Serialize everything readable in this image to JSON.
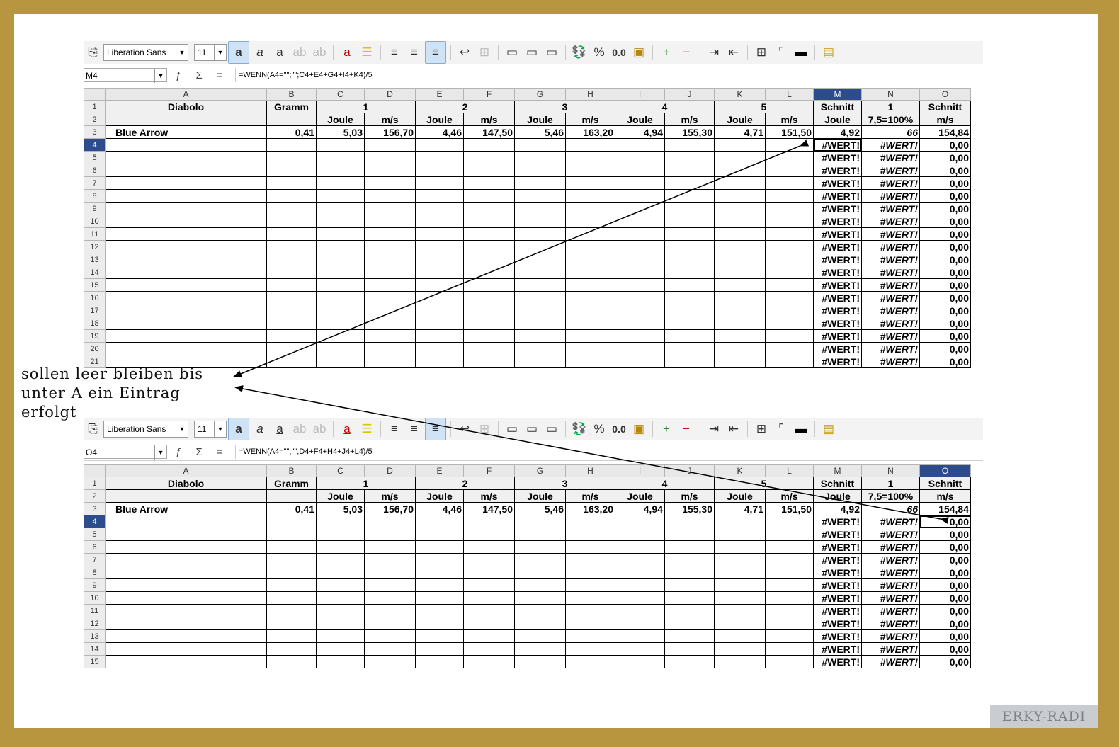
{
  "toolbar": {
    "font_name": "Liberation Sans",
    "font_size": "11",
    "percent_label": "%",
    "number_format_label": "0.0"
  },
  "top_panel": {
    "name_box": "M4",
    "formula": "=WENN(A4=\"\";\"\";C4+E4+G4+I4+K4)/5",
    "selected_column": "M",
    "visible_rows": 21
  },
  "bottom_panel": {
    "name_box": "O4",
    "formula": "=WENN(A4=\"\";\"\";D4+F4+H4+J4+L4)/5",
    "selected_column": "O",
    "visible_rows": 15
  },
  "sheet": {
    "column_letters": [
      "A",
      "B",
      "C",
      "D",
      "E",
      "F",
      "G",
      "H",
      "I",
      "J",
      "K",
      "L",
      "M",
      "N",
      "O"
    ],
    "row1": {
      "a": "Diabolo",
      "b": "Gramm",
      "g1": "1",
      "g2": "2",
      "g3": "3",
      "g4": "4",
      "g5": "5",
      "m": "Schnitt",
      "n": "1",
      "o": "Schnitt"
    },
    "row2": {
      "joule": "Joule",
      "ms": "m/s",
      "m": "Joule",
      "n": "7,5=100%",
      "o": "m/s"
    },
    "row3": {
      "a": "Blue Arrow",
      "b": "0,41",
      "c": "5,03",
      "d": "156,70",
      "e": "4,46",
      "f": "147,50",
      "g": "5,46",
      "h": "163,20",
      "i": "4,94",
      "j": "155,30",
      "k": "4,71",
      "l": "151,50",
      "m": "4,92",
      "n": "66",
      "o": "154,84"
    },
    "error_m": "#WERT!",
    "error_n": "#WERT!",
    "zero_o": "0,00"
  },
  "annotation": {
    "line1": "sollen leer bleiben bis",
    "line2": "unter A ein Eintrag",
    "line3": "erfolgt"
  },
  "watermark": "ERKY-RADI"
}
